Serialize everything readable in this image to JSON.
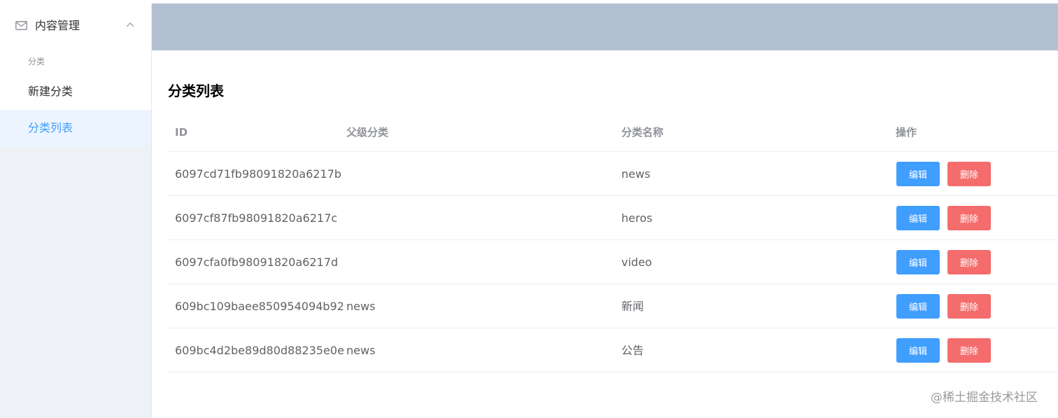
{
  "sidebar": {
    "submenu_title": "内容管理",
    "group_title": "分类",
    "items": [
      {
        "label": "新建分类",
        "active": false
      },
      {
        "label": "分类列表",
        "active": true
      }
    ]
  },
  "main": {
    "title": "分类列表",
    "columns": [
      "ID",
      "父级分类",
      "分类名称",
      "操作"
    ],
    "rows": [
      {
        "id": "6097cd71fb98091820a6217b",
        "parent": "",
        "name": "news"
      },
      {
        "id": "6097cf87fb98091820a6217c",
        "parent": "",
        "name": "heros"
      },
      {
        "id": "6097cfa0fb98091820a6217d",
        "parent": "",
        "name": "video"
      },
      {
        "id": "609bc109baee850954094b92",
        "parent": "news",
        "name": "新闻"
      },
      {
        "id": "609bc4d2be89d80d88235e0e",
        "parent": "news",
        "name": "公告"
      }
    ],
    "edit_label": "编辑",
    "delete_label": "删除"
  },
  "watermark": "@稀土掘金技术社区",
  "colors": {
    "header": "#b3c0d1",
    "sidebar": "#eef1f6",
    "active_item_bg": "#ecf5ff",
    "primary": "#409eff",
    "danger": "#f56c6c"
  },
  "icons": {
    "submenu_icon": "mail-icon",
    "submenu_toggle": "chevron-up-icon"
  }
}
